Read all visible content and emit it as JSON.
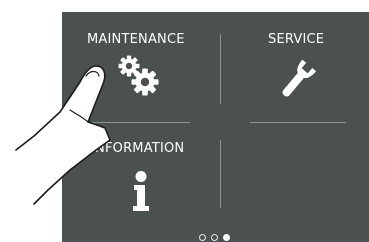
{
  "menu": {
    "tiles": [
      {
        "label": "MAINTENANCE",
        "icon": "gears-icon"
      },
      {
        "label": "SERVICE",
        "icon": "wrench-icon"
      },
      {
        "label": "INFORMATION",
        "icon": "info-icon"
      }
    ]
  },
  "pagination": {
    "count": 3,
    "active_index": 2
  },
  "colors": {
    "panel": "#4b5051",
    "divider": "#8e9394",
    "text": "#ffffff"
  }
}
